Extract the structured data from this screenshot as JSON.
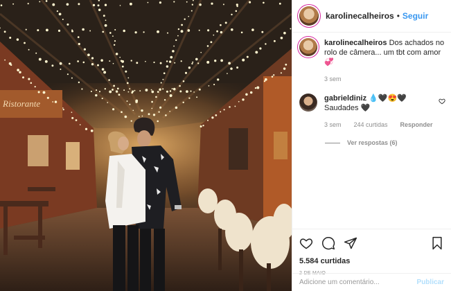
{
  "post": {
    "author": "karolinecalheiros",
    "separator": "•",
    "follow_label": "Seguir",
    "caption_text": "Dos achados no rolo de câmera... um tbt com amor",
    "caption_age": "3 sem"
  },
  "photo": {
    "sign_text": "Ristorante"
  },
  "comments": [
    {
      "author": "gabrieldiniz",
      "author_emoji": "💧🖤😍🖤",
      "text": "Saudades 🖤",
      "age": "3 sem",
      "likes": "244 curtidas",
      "reply_label": "Responder",
      "view_replies": "Ver respostas (6)"
    }
  ],
  "engagement": {
    "likes": "5.584 curtidas",
    "date": "2 DE MAIO"
  },
  "compose": {
    "placeholder": "Adicione um comentário...",
    "publish_label": "Publicar"
  },
  "icons": [
    "heart-icon",
    "comment-icon",
    "share-icon",
    "bookmark-icon"
  ]
}
